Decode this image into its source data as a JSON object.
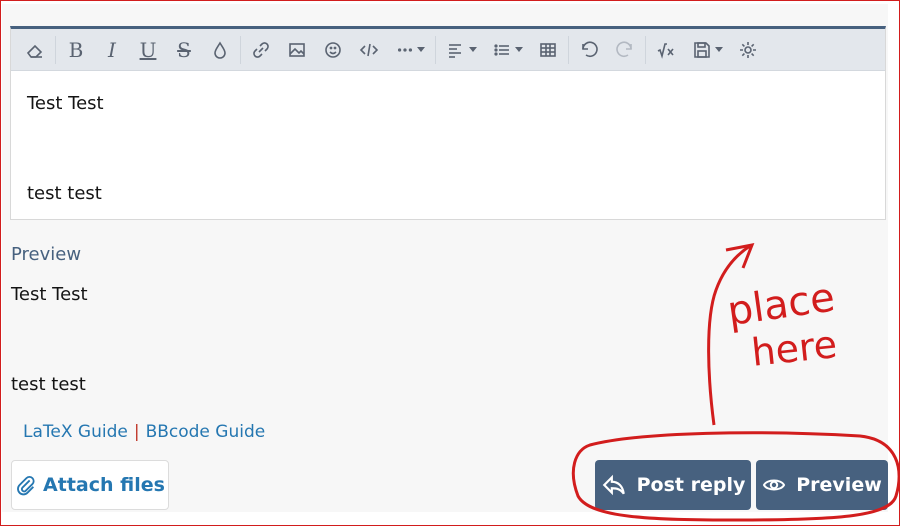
{
  "toolbar": {
    "icons": [
      "eraser-icon",
      "bold-icon",
      "italic-icon",
      "underline-icon",
      "strikethrough-icon",
      "color-drop-icon",
      "link-icon",
      "image-icon",
      "smiley-icon",
      "code-icon",
      "more-icon",
      "align-icon",
      "list-icon",
      "table-icon",
      "undo-icon",
      "redo-icon",
      "math-icon",
      "save-draft-icon",
      "settings-icon"
    ],
    "bold": "B",
    "italic": "I",
    "underline": "U",
    "strike": "S"
  },
  "editor": {
    "line1": "Test Test",
    "line2": "test test"
  },
  "preview": {
    "label": "Preview",
    "line1": "Test Test",
    "line2": "test test"
  },
  "guides": {
    "latex": "LaTeX Guide",
    "separator": "|",
    "bbcode": "BBcode Guide"
  },
  "actions": {
    "attach": "Attach files",
    "post_reply": "Post reply",
    "preview": "Preview"
  },
  "annotation": {
    "line1": "place",
    "line2": "here"
  },
  "colors": {
    "accent": "#47617f",
    "link": "#2577b1",
    "annotation": "#d21d1d"
  }
}
